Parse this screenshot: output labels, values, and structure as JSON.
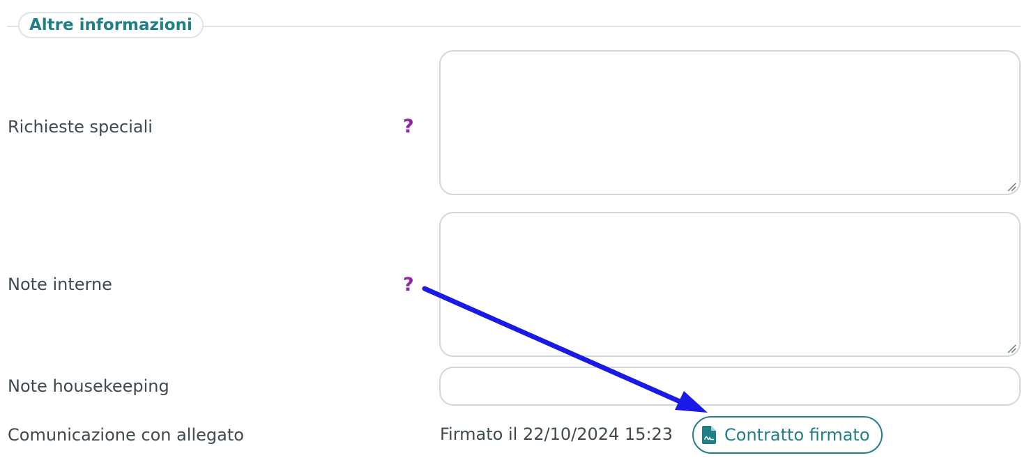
{
  "section": {
    "title": "Altre informazioni"
  },
  "fields": {
    "special_requests": {
      "label": "Richieste speciali",
      "help": "?",
      "value": ""
    },
    "internal_notes": {
      "label": "Note interne",
      "help": "?",
      "value": ""
    },
    "housekeeping_notes": {
      "label": "Note housekeeping",
      "value": ""
    },
    "attachment_communication": {
      "label": "Comunicazione con allegato",
      "signed_text": "Firmato il 22/10/2024 15:23",
      "button_label": "Contratto firmato",
      "button_icon": "signed-document-icon"
    }
  },
  "annotation": {
    "type": "arrow",
    "color": "#1a1ae6"
  },
  "colors": {
    "accent": "#1f7f85",
    "help": "#8e27a7",
    "border": "#cfd8dc",
    "text": "#3f4a4f"
  }
}
